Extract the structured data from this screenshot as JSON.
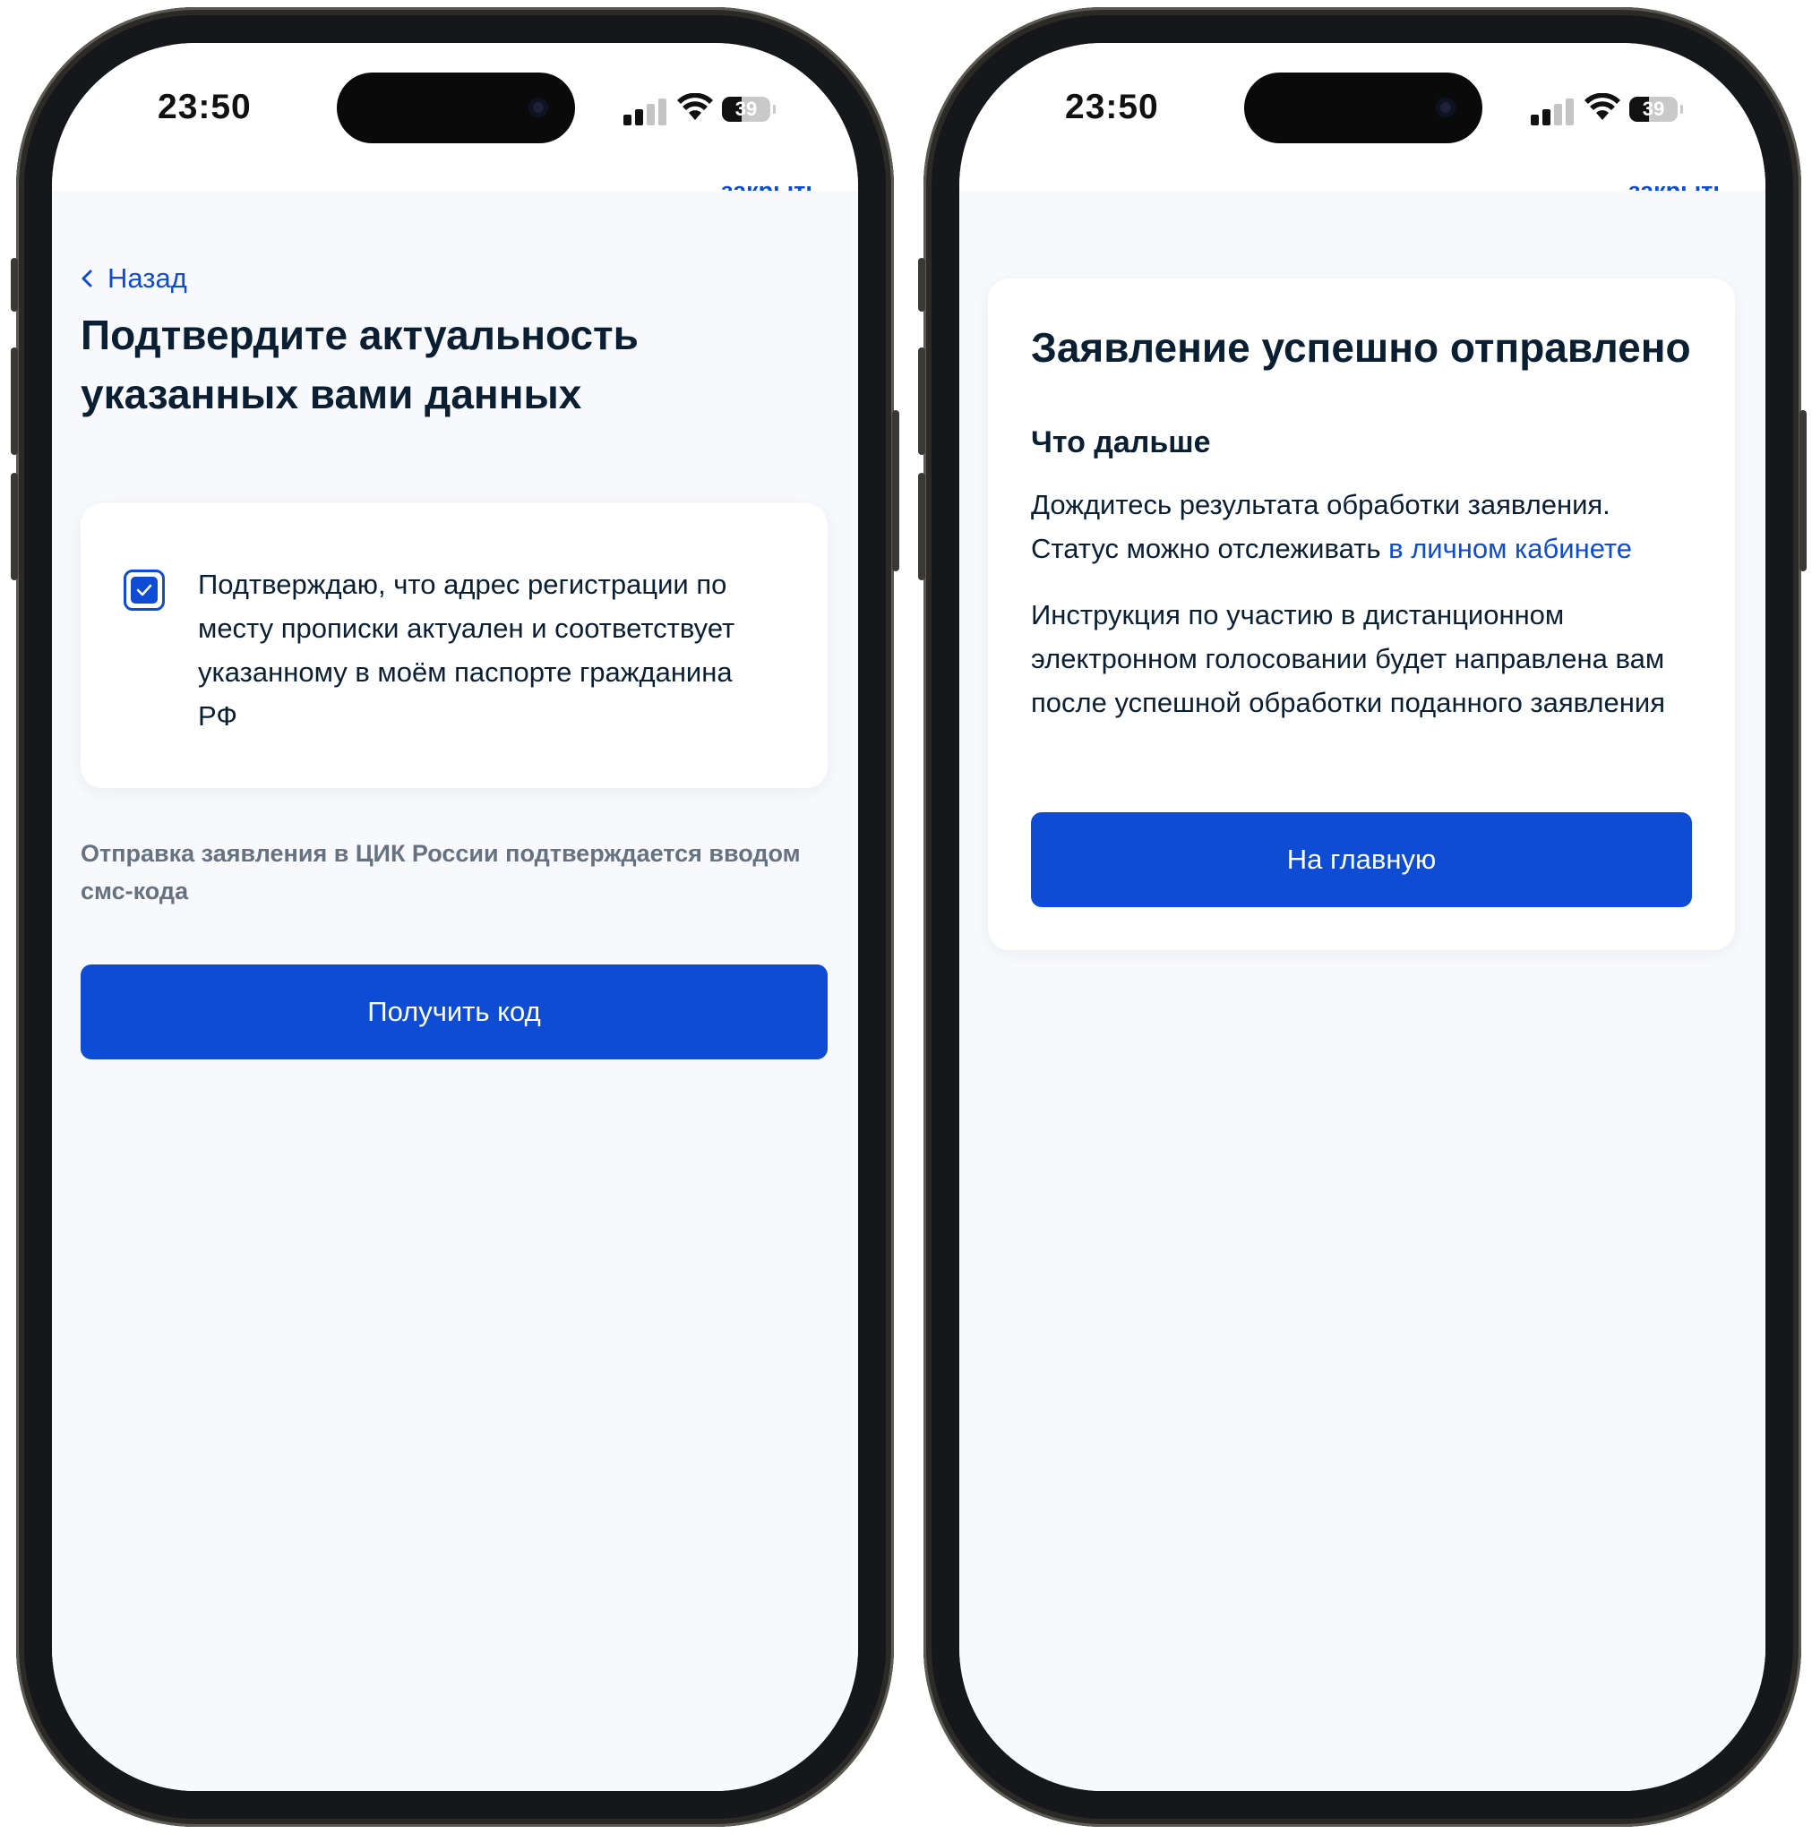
{
  "left_screen": {
    "status": {
      "time": "23:50",
      "battery": "39"
    },
    "close_label": "закрыть",
    "back_label": "Назад",
    "title": "Подтвердите актуальность указанных вами данных",
    "checkbox_text": "Подтверждаю, что адрес регистрации по месту прописки актуален и соответствует указанному в моём паспорте гражданина РФ",
    "checkbox_checked": true,
    "note": "Отправка заявления в ЦИК России подтверждается вводом смс-кода",
    "button_label": "Получить код"
  },
  "right_screen": {
    "status": {
      "time": "23:50",
      "battery": "39"
    },
    "close_label": "закрыть",
    "title": "Заявление успешно отправлено",
    "subtitle": "Что дальше",
    "paragraph1": "Дождитесь результата обработки заявления. Статус можно отслеживать",
    "paragraph1_link": "в личном кабинете",
    "paragraph2": "Инструкция по участию в дистанционном электронном голосовании будет направлена вам после успешной обработки поданного заявления",
    "button_label": "На главную"
  },
  "colors": {
    "accent": "#0d4cd3",
    "text": "#0b1f33",
    "muted": "#66727f",
    "background": "#f8f9fd"
  },
  "icons": [
    "chevron-left-icon",
    "checkmark-icon",
    "cellular-signal-icon",
    "wifi-icon",
    "battery-icon"
  ]
}
